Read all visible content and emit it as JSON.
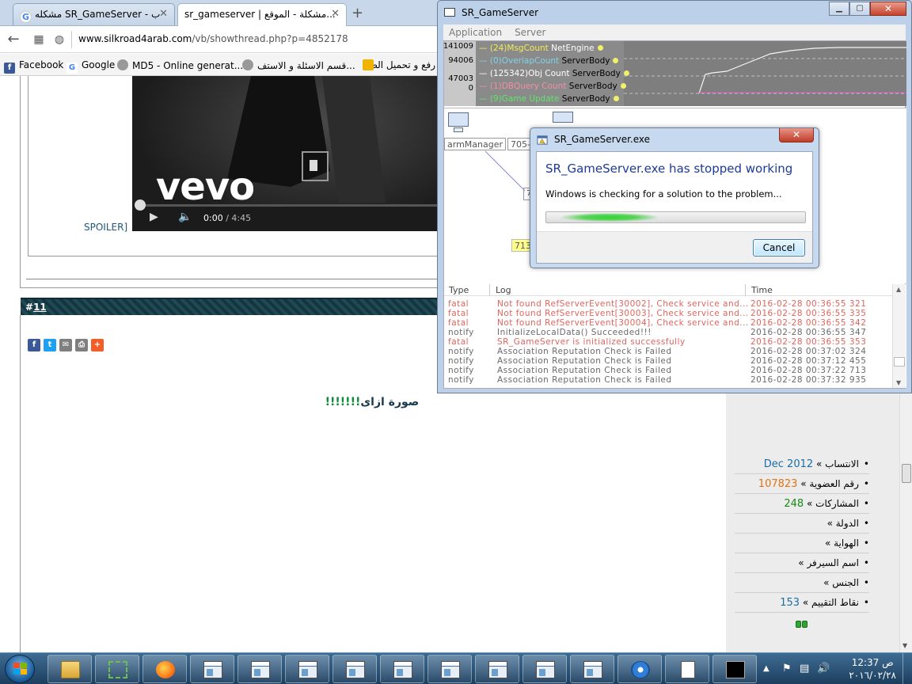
{
  "browser": {
    "tabs": [
      {
        "label": "مشكله SR_GameServer - ب"
      },
      {
        "label": "sr_gameserver | مشكلة - الموقع..."
      }
    ],
    "url_host": "www.silkroad4arab.com",
    "url_path": "/vb/showthread.php?p=4852178",
    "bookmarks": [
      {
        "label": "Facebook"
      },
      {
        "label": "Google"
      },
      {
        "label": "MD5 - Online generat..."
      },
      {
        "label": "قسم الاسئلة و الاستف..."
      },
      {
        "label": "رفع و تحميل الصور"
      }
    ]
  },
  "video": {
    "logo": "vevo",
    "time_current": "0:00",
    "time_total": " / 4:45",
    "progress": 0
  },
  "post": {
    "spoiler_label": "SPOILER]",
    "number_prefix": "#",
    "number": "11",
    "title_text": "صورة ازاى",
    "title_marks": "!!!!!!!",
    "share_icons": [
      "facebook-icon",
      "twitter-icon",
      "email-icon",
      "print-icon",
      "more-icon"
    ]
  },
  "user_info": [
    {
      "label": "الانتساب »",
      "value": "Dec 2012",
      "color": "#1c6ea4"
    },
    {
      "label": "رقم العضوية »",
      "value": "107823",
      "color": "#e27310"
    },
    {
      "label": "المشاركات »",
      "value": "248",
      "color": "#178a17"
    },
    {
      "label": "الدولة »",
      "value": ""
    },
    {
      "label": "الهواية »",
      "value": ""
    },
    {
      "label": "اسم السيرفر »",
      "value": ""
    },
    {
      "label": "الجنس »",
      "value": ""
    },
    {
      "label": "نقاط التقييم »",
      "value": "153",
      "color": "#1c6ea4"
    }
  ],
  "gameserver": {
    "title": "SR_GameServer",
    "menu": [
      "Application",
      "Server"
    ],
    "graph_y_ticks": [
      "141009",
      "94006",
      "47003",
      "0"
    ],
    "legend": [
      {
        "count": "(24)MsgCount",
        "obj": "NetEngine",
        "color": "#f2ea5a"
      },
      {
        "count": "(0)OverlapCount",
        "obj": "ServerBody",
        "color": "#7fd3e8"
      },
      {
        "count": "(125342)Obj Count",
        "obj": "ServerBody",
        "color": "#ffffff"
      },
      {
        "count": "(1)DBQuery Count",
        "obj": "ServerBody",
        "color": "#f08fa8"
      },
      {
        "count": "(9)Game Update",
        "obj": "ServerBody",
        "color": "#62e36a"
      }
    ],
    "nodes": {
      "manager": "armManager",
      "port": "705-",
      "small": "7",
      "yellow": "713"
    },
    "log_headers": {
      "type": "Type",
      "log": "Log",
      "time": "Time"
    },
    "log_rows": [
      {
        "type": "fatal",
        "log": "Not found RefServerEvent[30002], Check service and...",
        "time": "2016-02-28 00:36:55 321"
      },
      {
        "type": "fatal",
        "log": "Not found RefServerEvent[30003], Check service and...",
        "time": "2016-02-28 00:36:55 335"
      },
      {
        "type": "fatal",
        "log": "Not found RefServerEvent[30004], Check service and...",
        "time": "2016-02-28 00:36:55 342"
      },
      {
        "type": "notify",
        "log": "InitializeLocalData() Succeeded!!!",
        "time": "2016-02-28 00:36:55 347"
      },
      {
        "type": "fatal",
        "log": "SR_GameServer is initialized successfully",
        "time": "2016-02-28 00:36:55 353"
      },
      {
        "type": "notify",
        "log": "Association Reputation Check is Failed",
        "time": "2016-02-28 00:37:02 324"
      },
      {
        "type": "notify",
        "log": "Association Reputation Check is Failed",
        "time": "2016-02-28 00:37:12 455"
      },
      {
        "type": "notify",
        "log": "Association Reputation Check is Failed",
        "time": "2016-02-28 00:37:22 713"
      },
      {
        "type": "notify",
        "log": "Association Reputation Check is Failed",
        "time": "2016-02-28 00:37:32 935"
      }
    ]
  },
  "dialog": {
    "title": "SR_GameServer.exe",
    "heading": "SR_GameServer.exe has stopped working",
    "message": "Windows is checking for a solution to the problem...",
    "cancel_label": "Cancel",
    "progress_indicator": "indeterminate"
  },
  "taskbar": {
    "time": "12:37 ص",
    "date": "٢٠١٦/٠٢/٢٨",
    "items": [
      "explorer-icon",
      "tools-icon",
      "firefox-icon",
      "window-icon",
      "window-icon",
      "window-icon",
      "window-icon",
      "window-icon",
      "window-icon",
      "window-icon",
      "window-icon",
      "app-icon",
      "document-icon",
      "console-icon"
    ]
  }
}
